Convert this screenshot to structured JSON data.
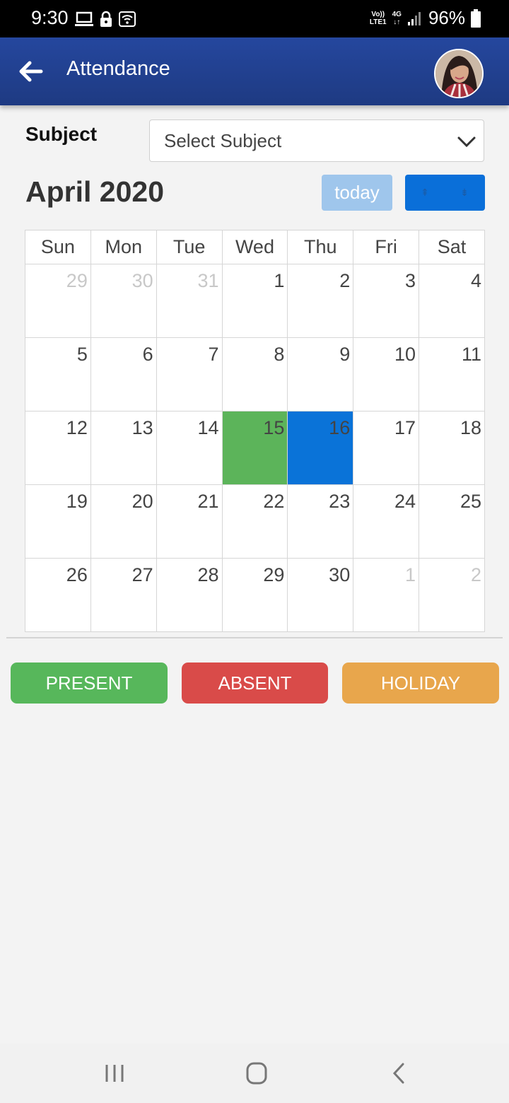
{
  "status_bar": {
    "time": "9:30",
    "network_top": "Vo))",
    "network_bottom": "LTE1",
    "network_type": "4G",
    "battery": "96%",
    "icons": [
      "laptop-icon",
      "lock-icon",
      "wifi-icon",
      "signal-icon",
      "battery-icon"
    ]
  },
  "app_bar": {
    "title": "Attendance"
  },
  "subject": {
    "label": "Subject",
    "selected": "Select Subject"
  },
  "calendar": {
    "title": "April 2020",
    "today_label": "today",
    "weekdays": [
      "Sun",
      "Mon",
      "Tue",
      "Wed",
      "Thu",
      "Fri",
      "Sat"
    ],
    "weeks": [
      [
        "29",
        "30",
        "31",
        "1",
        "2",
        "3",
        "4"
      ],
      [
        "5",
        "6",
        "7",
        "8",
        "9",
        "10",
        "11"
      ],
      [
        "12",
        "13",
        "14",
        "15",
        "16",
        "17",
        "18"
      ],
      [
        "19",
        "20",
        "21",
        "22",
        "23",
        "24",
        "25"
      ],
      [
        "26",
        "27",
        "28",
        "29",
        "30",
        "1",
        "2"
      ]
    ],
    "present_day": "15",
    "selected_day": "16"
  },
  "legend": {
    "present": "PRESENT",
    "absent": "ABSENT",
    "holiday": "HOLIDAY"
  },
  "colors": {
    "app_bar": "#25479e",
    "present": "#57b75b",
    "absent": "#d94b49",
    "holiday": "#e8a64c",
    "selected": "#0a73d8"
  }
}
